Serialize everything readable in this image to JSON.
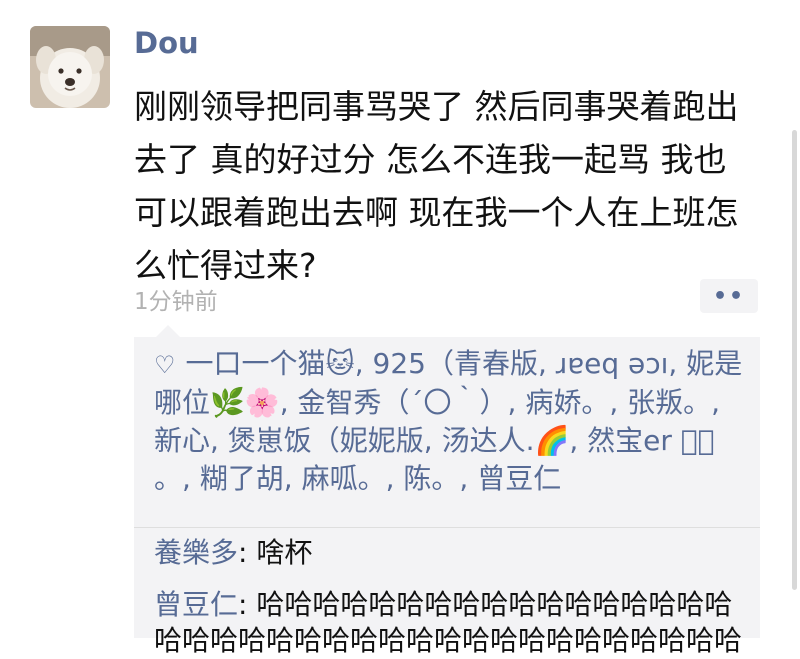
{
  "post": {
    "username": "Dou",
    "content": "刚刚领导把同事骂哭了 然后同事哭着跑出去了 真的好过分 怎么不连我一起骂 我也可以跟着跑出去啊 现在我一个人在上班怎么忙得过来?",
    "time": "1分钟前",
    "more_icon": "more-dots-icon"
  },
  "likes": {
    "icon": "heart-outline-icon",
    "text": "一口一个猫🐱, 925（青春版, ɹɐeq ǝɔı, 妮是哪位🌿🌸, 金智秀（´〇｀）, 病娇。, 张叛。, 新心, 煲崽饭（妮妮版, 汤达人.🌈, 然宝er ⌒ͧ 。, 糊了胡, 麻呱。, 陈。, 曾豆仁"
  },
  "comments": [
    {
      "author": "養樂多",
      "sep": ": ",
      "text": "啥杯"
    },
    {
      "author": "曾豆仁",
      "sep": ": ",
      "text": "哈哈哈哈哈哈哈哈哈哈哈哈哈哈哈哈哈哈哈哈哈哈哈哈哈哈哈哈哈哈哈哈哈哈哈哈哈哈"
    }
  ],
  "colors": {
    "link": "#576b95",
    "time": "#b2b2b2",
    "panel": "#f3f3f5"
  }
}
